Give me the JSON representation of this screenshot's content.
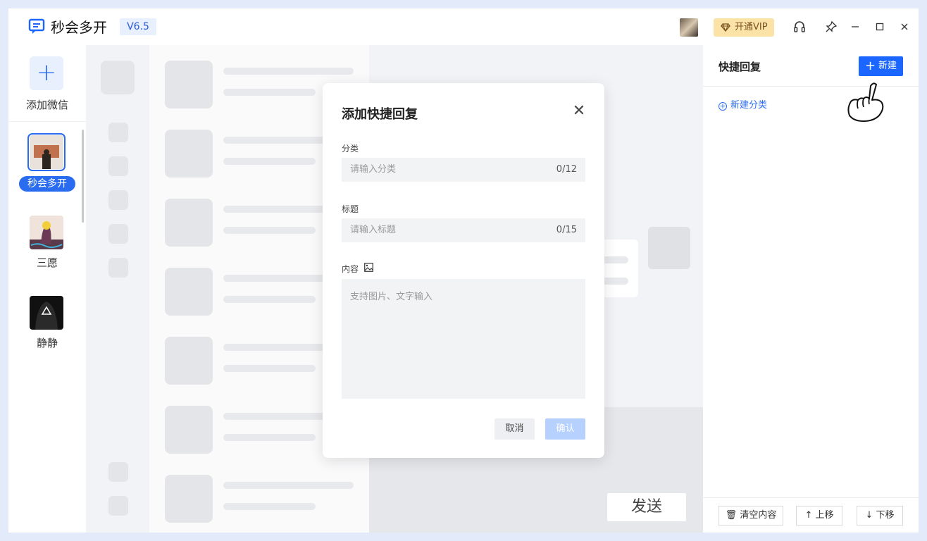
{
  "app": {
    "name": "秒会多开",
    "version": "V6.5",
    "vip_label": "开通VIP"
  },
  "accounts": {
    "add_label": "添加微信",
    "items": [
      {
        "name": "秒会多开",
        "active": true
      },
      {
        "name": "三愿",
        "active": false
      },
      {
        "name": "静静",
        "active": false
      }
    ]
  },
  "right_panel": {
    "title": "快捷回复",
    "new_button": "新建",
    "new_category": "新建分类",
    "clear_button": "清空内容",
    "move_up_button": "上移",
    "move_down_button": "下移"
  },
  "chat": {
    "send_button": "发送"
  },
  "modal": {
    "title": "添加快捷回复",
    "category_label": "分类",
    "category_placeholder": "请输入分类",
    "category_count": "0/12",
    "title_label": "标题",
    "title_placeholder": "请输入标题",
    "title_count": "0/15",
    "content_label": "内容",
    "content_placeholder": "支持图片、文字输入",
    "cancel_button": "取消",
    "confirm_button": "确认"
  },
  "colors": {
    "accent": "#1a66ff",
    "vip": "#fbe3a8",
    "confirm_disabled": "#b7d1ff"
  }
}
